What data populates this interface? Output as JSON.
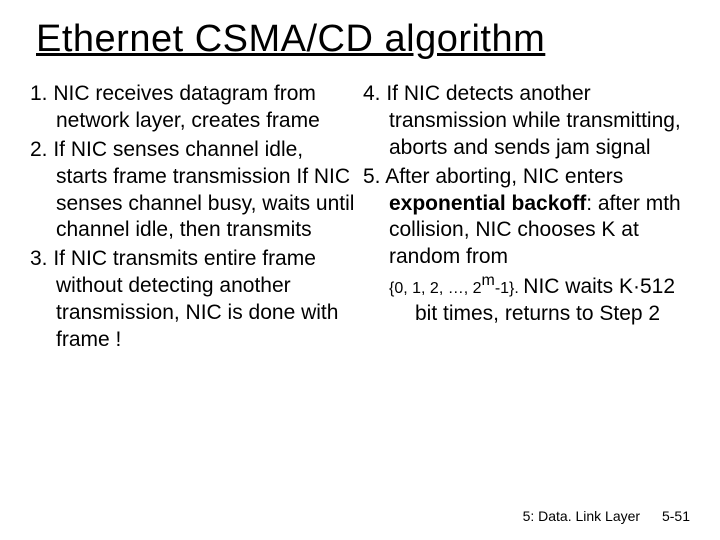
{
  "title": "Ethernet CSMA/CD algorithm",
  "left": {
    "p1": "1. NIC receives datagram from network layer, creates frame",
    "p2": "2. If NIC senses channel idle, starts frame transmission If NIC senses channel busy, waits until channel idle, then transmits",
    "p3": "3. If NIC transmits entire frame without detecting another transmission, NIC is done with frame !"
  },
  "right": {
    "p4": "4. If NIC detects another transmission while transmitting,  aborts and sends jam signal",
    "p5a": "5. After aborting, NIC enters ",
    "p5b_bold": "exponential backoff",
    "p5c": ": after mth collision, NIC chooses K at random from",
    "p5d_small": "{0, 1, 2, …, 2",
    "p5d_sup": "m",
    "p5d_small2": "-1}. ",
    "p5e": "NIC waits K·512 bit times, returns to Step 2"
  },
  "footer": {
    "section": "5: Data. Link Layer",
    "page": "5-51"
  }
}
